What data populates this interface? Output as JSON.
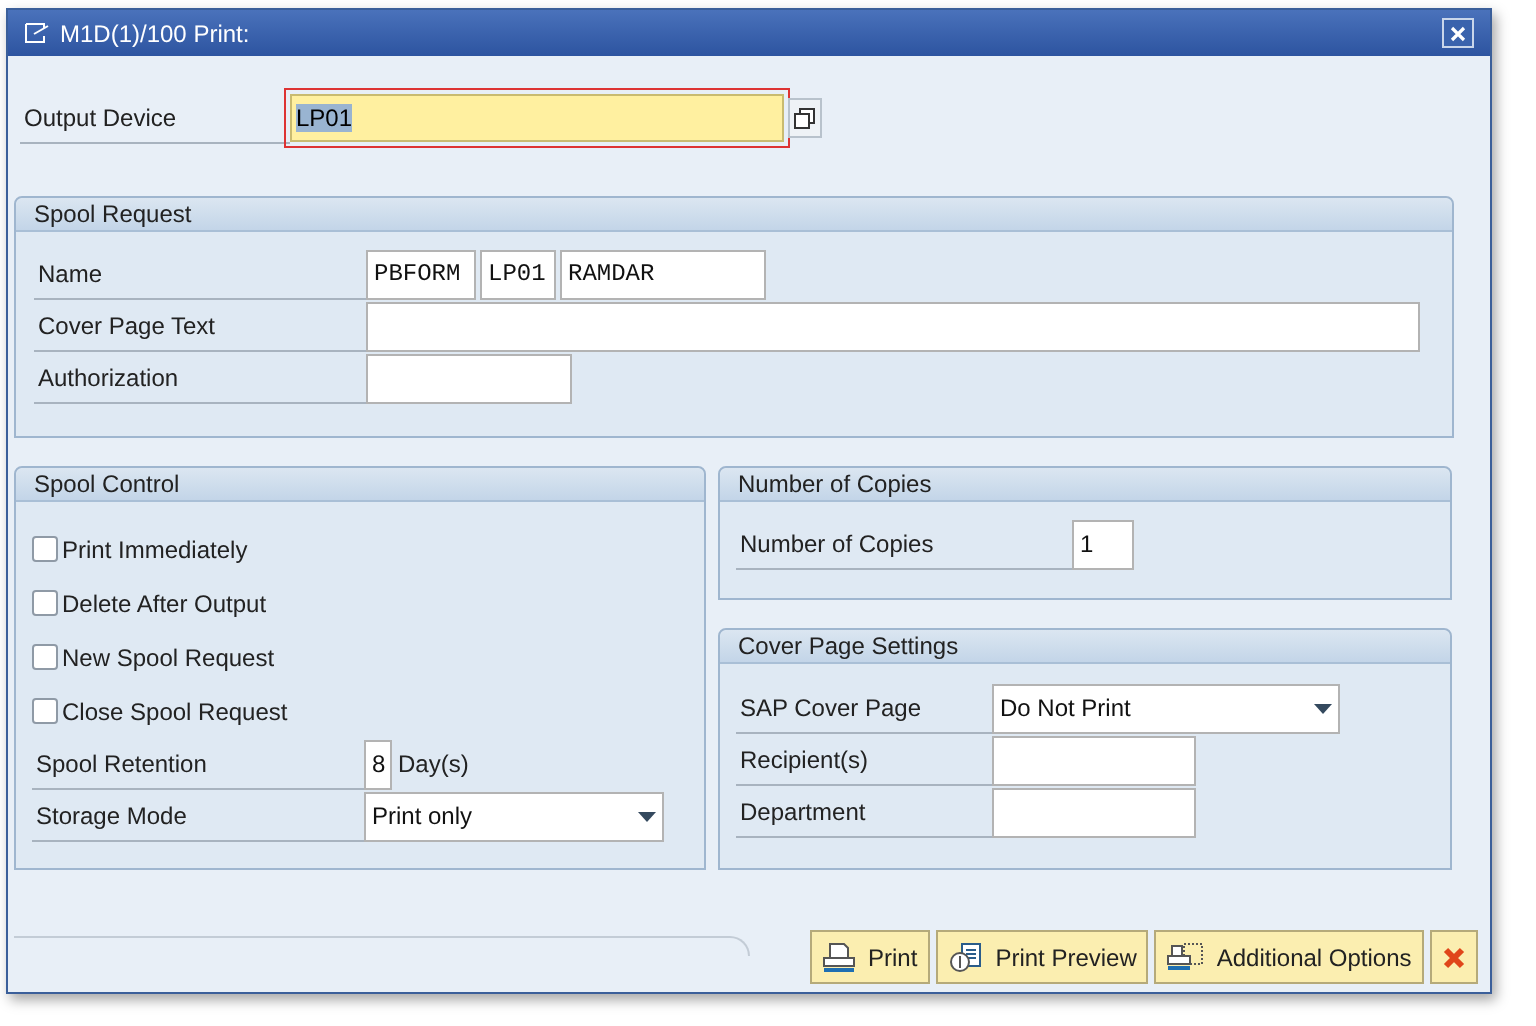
{
  "window": {
    "title": "M1D(1)/100 Print:"
  },
  "output_device": {
    "label": "Output Device",
    "value": "LP01",
    "highlighted": true
  },
  "spool_request": {
    "title": "Spool Request",
    "name": {
      "label": "Name",
      "values": [
        "PBFORM",
        "LP01",
        "RAMDAR"
      ]
    },
    "cover_page_text": {
      "label": "Cover Page Text"
    },
    "authorization": {
      "label": "Authorization"
    }
  },
  "spool_control": {
    "title": "Spool Control",
    "options": [
      {
        "label": "Print Immediately",
        "checked": false
      },
      {
        "label": "Delete After Output",
        "checked": false
      },
      {
        "label": "New Spool Request",
        "checked": false
      },
      {
        "label": "Close Spool Request",
        "checked": false
      }
    ],
    "spool_retention": {
      "label": "Spool Retention",
      "value": "8",
      "unit": "Day(s)"
    },
    "storage_mode": {
      "label": "Storage Mode",
      "value": "Print only"
    }
  },
  "number_of_copies": {
    "title": "Number of Copies",
    "label": "Number of Copies",
    "value": "1"
  },
  "cover_page_settings": {
    "title": "Cover Page Settings",
    "sap_cover_page": {
      "label": "SAP Cover Page",
      "value": "Do Not Print"
    },
    "recipients": {
      "label": "Recipient(s)"
    },
    "department": {
      "label": "Department"
    }
  },
  "buttons": [
    {
      "kind": "print",
      "label": "Print"
    },
    {
      "kind": "preview",
      "label": "Print Preview"
    },
    {
      "kind": "options",
      "label": "Additional Options"
    },
    {
      "kind": "cancel"
    }
  ]
}
